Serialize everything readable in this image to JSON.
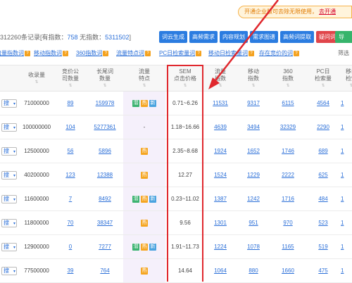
{
  "promo": {
    "text": "开通企业版可去除无限使用，",
    "link": "去开通"
  },
  "records": {
    "prefix": "312260条记录[有指数：",
    "with_index": "758",
    "mid": " 无指数：",
    "no_index": "5311502",
    "suffix": "]"
  },
  "buttons": [
    "词云生成",
    "高频需求",
    "内容规划",
    "需求图谱",
    "高频词提取",
    "疑问词提取"
  ],
  "export_button": "导 ",
  "filters": [
    "流量指数词",
    "移动指数词",
    "360指数词",
    "流量特点词",
    "PC日检索量词",
    "移动日检索量词",
    "存在竞价的词"
  ],
  "filter_right": "筛选",
  "headers": {
    "col_search": [
      "收录量"
    ],
    "col_bid": [
      "竞价公",
      "司数量"
    ],
    "col_long": [
      "长尾词",
      "数量"
    ],
    "col_feature": [
      "流量",
      "特点"
    ],
    "col_sem": [
      "SEM",
      "点击价格"
    ],
    "col_idx": [
      "流量",
      "指数"
    ],
    "col_mobile": [
      "移动",
      "指数"
    ],
    "col_360": [
      "360",
      "指数"
    ],
    "col_pc": [
      "PC日",
      "检索量"
    ],
    "col_last": [
      "移动",
      "检索"
    ]
  },
  "row_select_label": "搜",
  "rows": [
    {
      "shoulu": "71000000",
      "bid": "89",
      "long": "159978",
      "tags": [
        "潜",
        "热",
        "新"
      ],
      "sem": "0.71~6.26",
      "idx": "11531",
      "mobile": "9317",
      "i360": "6115",
      "pc": "4564",
      "last": "1"
    },
    {
      "shoulu": "100000000",
      "bid": "104",
      "long": "5277361",
      "tags": [],
      "feature_text": "-",
      "sem": "1.18~16.66",
      "idx": "4639",
      "mobile": "3494",
      "i360": "32329",
      "pc": "2290",
      "last": "1"
    },
    {
      "shoulu": "12500000",
      "bid": "56",
      "long": "5896",
      "tags": [
        "热"
      ],
      "sem": "2.35~8.68",
      "idx": "1924",
      "mobile": "1652",
      "i360": "1746",
      "pc": "689",
      "last": "1"
    },
    {
      "shoulu": "40200000",
      "bid": "123",
      "long": "12388",
      "tags": [
        "热"
      ],
      "sem": "12.27",
      "idx": "1524",
      "mobile": "1229",
      "i360": "2222",
      "pc": "625",
      "last": "1"
    },
    {
      "shoulu": "11600000",
      "bid": "7",
      "long": "8492",
      "tags": [
        "潜",
        "热",
        "新"
      ],
      "sem": "0.23~11.02",
      "idx": "1387",
      "mobile": "1242",
      "i360": "1716",
      "pc": "484",
      "last": "1"
    },
    {
      "shoulu": "11800000",
      "bid": "70",
      "long": "38347",
      "tags": [
        "热"
      ],
      "sem": "9.56",
      "idx": "1301",
      "mobile": "951",
      "i360": "970",
      "pc": "523",
      "last": "1"
    },
    {
      "shoulu": "12900000",
      "bid": "0",
      "long": "7277",
      "tags": [
        "潜",
        "热",
        "新"
      ],
      "sem": "1.91~11.73",
      "idx": "1224",
      "mobile": "1078",
      "i360": "1165",
      "pc": "519",
      "last": "1"
    },
    {
      "shoulu": "77500000",
      "bid": "39",
      "long": "764",
      "tags": [
        "热"
      ],
      "sem": "14.64",
      "idx": "1064",
      "mobile": "880",
      "i360": "1660",
      "pc": "475",
      "last": "1"
    }
  ],
  "colors": {
    "accent": "#2b7ce0",
    "highlight": "#e0282e",
    "tag_green": "#3cb371",
    "tag_orange": "#f5a623",
    "tag_blue": "#4aa3df"
  }
}
